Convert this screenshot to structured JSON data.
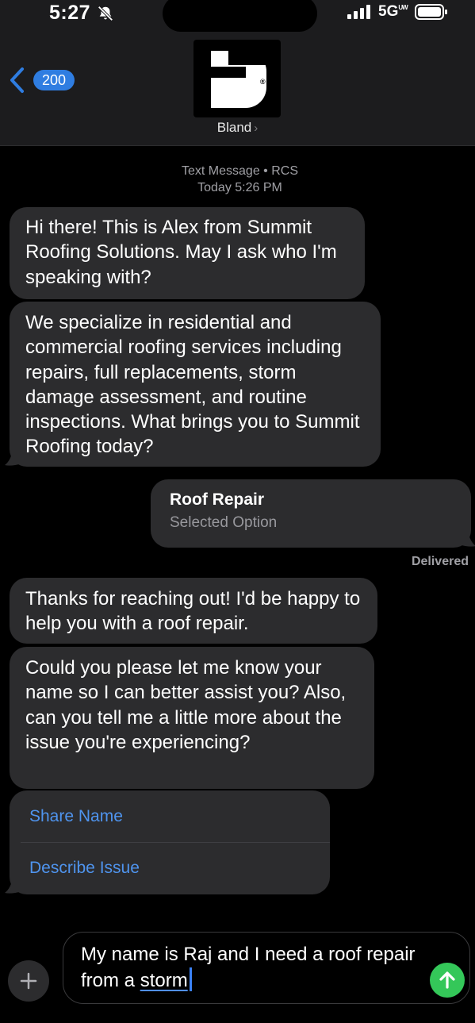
{
  "status_bar": {
    "time": "5:27",
    "network": "5G",
    "network_suffix": "UW",
    "icons": [
      "bell-slash-icon",
      "signal-icon",
      "battery-icon"
    ]
  },
  "header": {
    "back_count": "200",
    "contact_name": "Bland",
    "contact_chevron": "›"
  },
  "conversation": {
    "meta_line1": "Text Message • RCS",
    "meta_line2": "Today 5:26 PM",
    "messages": [
      {
        "from": "them",
        "text": "Hi there! This is Alex from Summit Roofing Solutions. May I ask who I'm speaking with?"
      },
      {
        "from": "them",
        "text": "We specialize in residential and commercial roofing services including repairs, full replacements, storm damage assessment, and routine inspections. What brings you to Summit Roofing today?"
      },
      {
        "from": "me",
        "title": "Roof Repair",
        "subtitle": "Selected Option"
      },
      {
        "from": "them",
        "text": "Thanks for reaching out! I'd be happy to help you with a roof repair."
      },
      {
        "from": "them",
        "text": "Could you please let me know your name so I can better assist you? Also, can you tell me a little more about the issue you're experiencing?"
      }
    ],
    "delivered": "Delivered",
    "suggestions": [
      "Share Name",
      "Describe Issue"
    ]
  },
  "composer": {
    "text_before": "My name is Raj and I need a roof repair from a ",
    "text_underlined": "storm"
  },
  "colors": {
    "accent_blue": "#2f7de1",
    "link_blue": "#4f94ee",
    "send_green": "#34c759",
    "bubble_gray": "#2c2c2e"
  }
}
